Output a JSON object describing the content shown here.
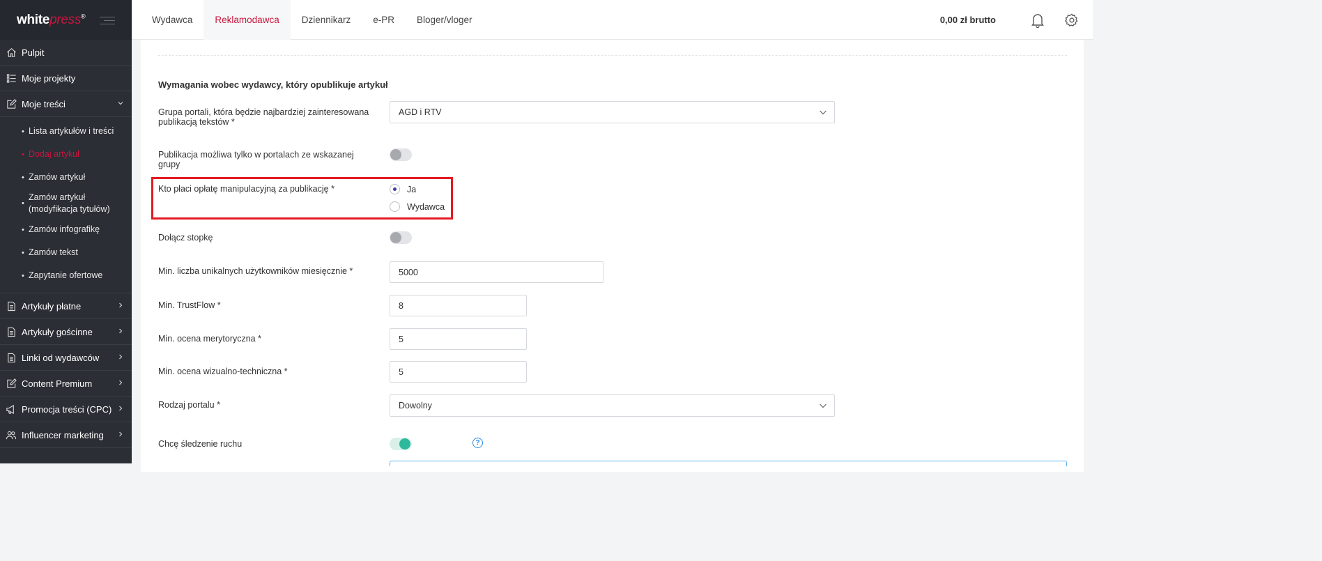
{
  "brand": {
    "white": "white",
    "press": "press",
    "mark": "®"
  },
  "colors": {
    "accent": "#c8163e",
    "sidebar_bg": "#2b2e35",
    "toggle_on": "#2eb99c",
    "highlight": "#e41b23",
    "help": "#2a8adf"
  },
  "sidebar": {
    "items": [
      {
        "label": "Pulpit",
        "icon": "home-icon"
      },
      {
        "label": "Moje projekty",
        "icon": "list-icon"
      },
      {
        "label": "Moje treści",
        "icon": "edit-icon",
        "expanded": true
      },
      {
        "label": "Artykuły płatne",
        "icon": "document-icon"
      },
      {
        "label": "Artykuły gościnne",
        "icon": "document-icon"
      },
      {
        "label": "Linki od wydawców",
        "icon": "document-icon"
      },
      {
        "label": "Content Premium",
        "icon": "edit-icon"
      },
      {
        "label": "Promocja treści (CPC)",
        "icon": "megaphone-icon"
      },
      {
        "label": "Influencer marketing",
        "icon": "users-icon"
      }
    ],
    "submenu": [
      {
        "label": "Lista artykułów i treści"
      },
      {
        "label": "Dodaj artykuł",
        "active": true
      },
      {
        "label": "Zamów artykuł"
      },
      {
        "label": "Zamów artykuł (modyfikacja tytułów)"
      },
      {
        "label": "Zamów infografikę"
      },
      {
        "label": "Zamów tekst"
      },
      {
        "label": "Zapytanie ofertowe"
      }
    ]
  },
  "header": {
    "tabs": [
      {
        "label": "Wydawca"
      },
      {
        "label": "Reklamodawca",
        "active": true
      },
      {
        "label": "Dziennikarz"
      },
      {
        "label": "e-PR"
      },
      {
        "label": "Bloger/vloger"
      }
    ],
    "balance": "0,00 zł brutto"
  },
  "form": {
    "section_title": "Wymagania wobec wydawcy, który opublikuje artykuł",
    "portal_group": {
      "label": "Grupa portali, która będzie najbardziej zainteresowana publikacją tekstów *",
      "value": "AGD i RTV"
    },
    "only_group": {
      "label": "Publikacja możliwa tylko w portalach ze wskazanej grupy",
      "on": false
    },
    "fee_payer": {
      "label": "Kto płaci opłatę manipulacyjną za publikację *",
      "options": [
        "Ja",
        "Wydawca"
      ],
      "selected": "Ja"
    },
    "footer": {
      "label": "Dołącz stopkę",
      "on": false
    },
    "min_users": {
      "label": "Min. liczba unikalnych użytkowników miesięcznie *",
      "value": "5000"
    },
    "min_trustflow": {
      "label": "Min. TrustFlow *",
      "value": "8"
    },
    "min_merit": {
      "label": "Min. ocena merytoryczna *",
      "value": "5"
    },
    "min_visual": {
      "label": "Min. ocena wizualno-techniczna *",
      "value": "5"
    },
    "portal_type": {
      "label": "Rodzaj portalu *",
      "value": "Dowolny"
    },
    "tracking": {
      "label": "Chcę śledzenie ruchu",
      "on": true,
      "help": "?"
    }
  }
}
